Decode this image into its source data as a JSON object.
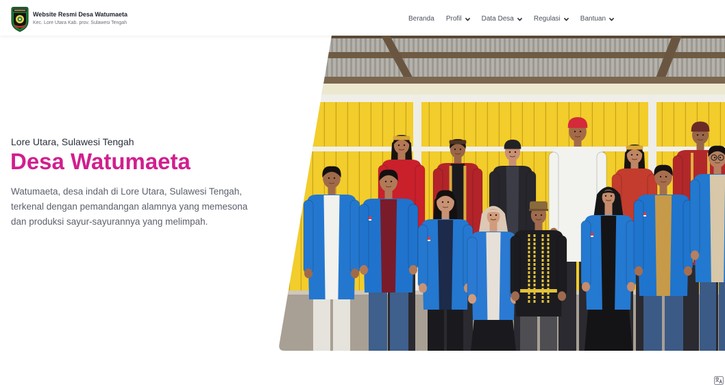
{
  "header": {
    "logo_icon": "village-emblem-icon",
    "title": "Website Resmi Desa Watumaeta",
    "subtitle": "Kec. Lore Utara Kab. prov. Sulawesi Tengah"
  },
  "nav": {
    "dropdown_icon": "chevron-down-icon",
    "items": [
      {
        "label": "Beranda",
        "has_dropdown": false
      },
      {
        "label": "Profil",
        "has_dropdown": true
      },
      {
        "label": "Data Desa",
        "has_dropdown": true
      },
      {
        "label": "Regulasi",
        "has_dropdown": true
      },
      {
        "label": "Bantuan",
        "has_dropdown": true
      }
    ]
  },
  "hero": {
    "eyebrow": "Lore Utara, Sulawesi Tengah",
    "title": "Desa Watumaeta",
    "description_lines": [
      "Watumaeta, desa indah di Lore Utara, Sulawesi Tengah,",
      "terkenal dengan pemandangan alamnya yang memesona",
      "dan produksi sayur-sayurannya yang melimpah."
    ]
  },
  "floating": {
    "translate_icon": "translate-icon"
  },
  "colors": {
    "accent": "#d11f8e",
    "heading": "#2b2e3a",
    "body_text": "#5c606b",
    "nav_text": "#4b505b"
  }
}
